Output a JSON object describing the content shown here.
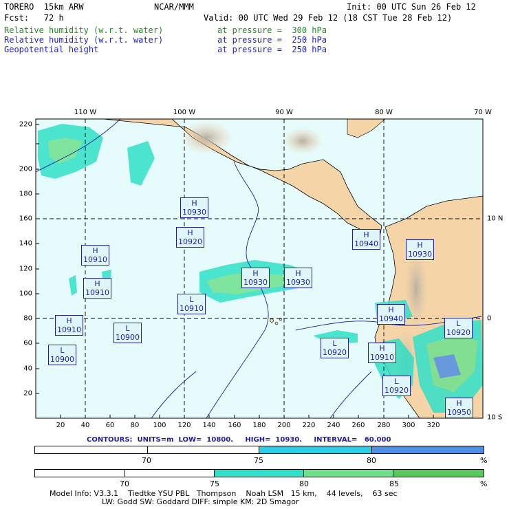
{
  "header": {
    "model": "TORERO  15km ARW",
    "org": "NCAR/MMM",
    "init": "Init: 00 UTC Sun 26 Feb 12",
    "fcst": "Fcst:   72 h",
    "valid": "Valid: 00 UTC Wed 29 Feb 12 (18 CST Tue 28 Feb 12)",
    "fields": [
      {
        "name": "Relative humidity (w.r.t. water)",
        "level": "at pressure =  300 hPa",
        "color": "#1f8f1f"
      },
      {
        "name": "Relative humidity (w.r.t. water)",
        "level": "at pressure =  250 hPa",
        "color": "#1e1ee6"
      },
      {
        "name": "Geopotential height",
        "level": "at pressure =  250 hPa",
        "color": "#000000"
      }
    ]
  },
  "axes": {
    "lon_labels": [
      "110 W",
      "100 W",
      "90 W",
      "80 W",
      "70 W"
    ],
    "lat_labels": [
      "10 N",
      "0",
      "10 S"
    ],
    "x_ticks": [
      "20",
      "40",
      "60",
      "80",
      "100",
      "120",
      "140",
      "160",
      "180",
      "200",
      "220",
      "240",
      "260",
      "280",
      "300",
      "320"
    ],
    "y_ticks": [
      "20",
      "40",
      "60",
      "80",
      "100",
      "120",
      "140",
      "160",
      "180",
      "200",
      "220"
    ]
  },
  "highs_lows": [
    {
      "type": "H",
      "value": "10930"
    },
    {
      "type": "H",
      "value": "10920"
    },
    {
      "type": "H",
      "value": "10910"
    },
    {
      "type": "H",
      "value": "10910"
    },
    {
      "type": "H",
      "value": "10930"
    },
    {
      "type": "H",
      "value": "10930"
    },
    {
      "type": "H",
      "value": "10940"
    },
    {
      "type": "H",
      "value": "10930"
    },
    {
      "type": "L",
      "value": "10910"
    },
    {
      "type": "H",
      "value": "10910"
    },
    {
      "type": "L",
      "value": "10900"
    },
    {
      "type": "L",
      "value": "10900"
    },
    {
      "type": "H",
      "value": "10940"
    },
    {
      "type": "L",
      "value": "10920"
    },
    {
      "type": "L",
      "value": "10920"
    },
    {
      "type": "H",
      "value": "10910"
    },
    {
      "type": "L",
      "value": "10920"
    },
    {
      "type": "H",
      "value": "10950"
    }
  ],
  "contour_info": "CONTOURS:  UNITS=m  LOW=  10800.     HIGH=  10930.     INTERVAL=   60.000",
  "colorbars": [
    {
      "labels": [
        "70",
        "75",
        "80"
      ],
      "unit": "%",
      "colors": [
        "#ffffff",
        "#ffffff",
        "#2ccfe6",
        "#4f8fe6"
      ]
    },
    {
      "labels": [
        "70",
        "75",
        "80",
        "85"
      ],
      "unit": "%",
      "colors": [
        "#ffffff",
        "#ffffff",
        "#30e0c8",
        "#6ee08e",
        "#58c858"
      ]
    }
  ],
  "footer": {
    "line1": "Model Info: V3.3.1    Tiedtke YSU PBL   Thompson    Noah LSM   15 km,    44 levels,    63 sec",
    "line2": "LW: Godd SW: Goddard DIFF: simple KM: 2D Smagor"
  },
  "colors": {
    "ocean": "#e6fcfc",
    "land": "#f5d5a8",
    "frame": "#000000",
    "label_blue": "#1e1ea0"
  }
}
